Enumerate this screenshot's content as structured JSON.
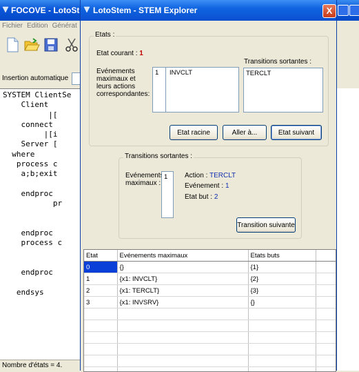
{
  "background_window": {
    "title": "FOCOVE - LotoStem",
    "menu": [
      "Fichier",
      "Edition",
      "Générat"
    ],
    "insertion_label": "Insertion automatique",
    "code_lines": [
      "SYSTEM ClientSe",
      "    Client",
      "          |[",
      "    connect",
      "         |[i",
      "    Server [",
      "  where",
      "   process c",
      "    a;b;exit",
      "",
      "    endproc",
      "           pr",
      "",
      "",
      "    endproc",
      "    process c",
      "",
      "",
      "    endproc",
      "",
      "   endsys"
    ],
    "status": "Nombre d'états = 4."
  },
  "dialog": {
    "title": "LotoStem - STEM Explorer",
    "close_label": "X",
    "etats": {
      "legend": "Etats :",
      "current_label": "Etat courant :",
      "current_value": "1",
      "events_label_lines": [
        "Evénements",
        "maximaux et",
        "leurs actions",
        "correspondantes:"
      ],
      "events_list": [
        {
          "num": "1",
          "name": "INVCLT"
        }
      ],
      "transitions_label": "Transitions sortantes :",
      "transitions_list": [
        "TERCLT"
      ],
      "btn_root": "Etat racine",
      "btn_goto": "Aller à...",
      "btn_next": "Etat suivant"
    },
    "transitions": {
      "legend": "Transitions sortantes :",
      "events_label_lines": [
        "Evénements",
        "maximaux :"
      ],
      "events_list": [
        "1"
      ],
      "action_label": "Action :",
      "action_value": "TERCLT",
      "event_label": "Evénement :",
      "event_value": "1",
      "target_label": "Etat but :",
      "target_value": "2",
      "btn_next": "Transition suivante"
    },
    "table": {
      "headers": [
        "Etat",
        "Evénements maximaux",
        "Etats buts"
      ],
      "rows": [
        [
          "0",
          "{}",
          "{1}"
        ],
        [
          "1",
          "{x1: INVCLT}",
          "{2}"
        ],
        [
          "2",
          "{x1: TERCLT}",
          "{3}"
        ],
        [
          "3",
          "{x1: INVSRV}",
          "{}"
        ]
      ],
      "selected_row": 0
    }
  }
}
